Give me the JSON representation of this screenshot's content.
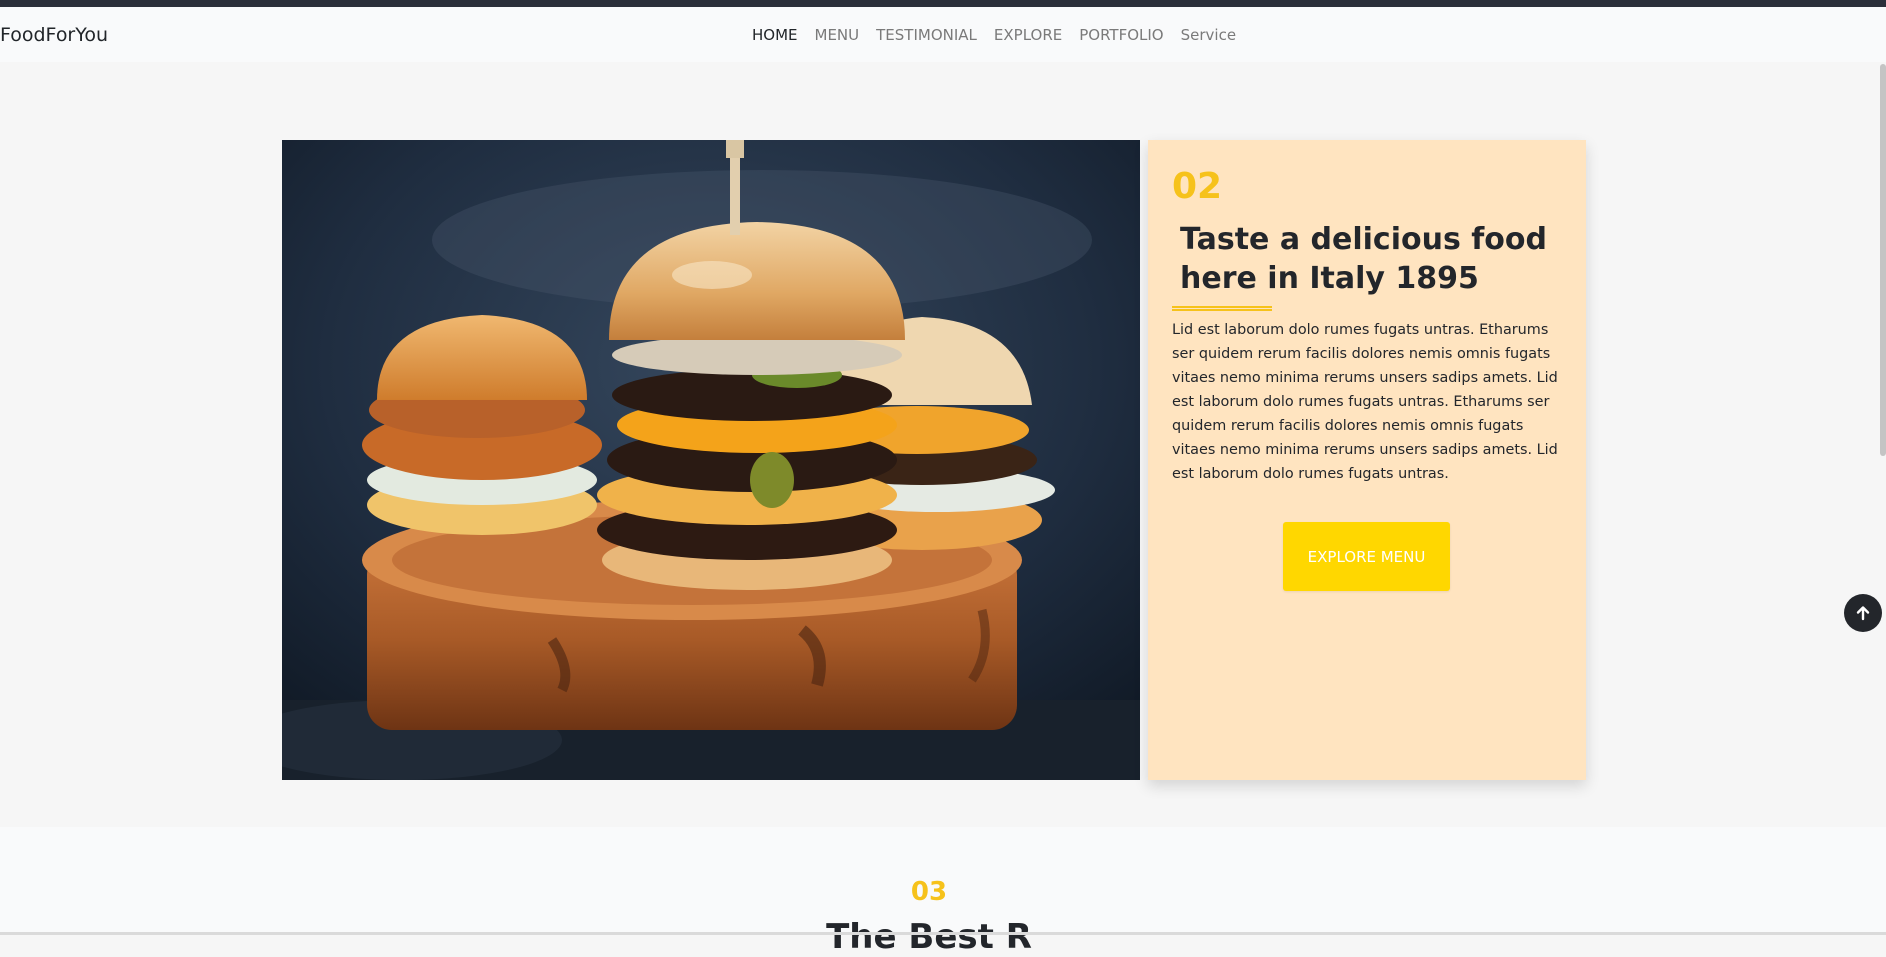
{
  "navbar": {
    "brand": "FoodForYou",
    "links": [
      {
        "label": "HOME",
        "active": true
      },
      {
        "label": "MENU",
        "active": false
      },
      {
        "label": "TESTIMONIAL",
        "active": false
      },
      {
        "label": "EXPLORE",
        "active": false
      },
      {
        "label": "PORTFOLIO",
        "active": false
      },
      {
        "label": "Service",
        "active": false
      }
    ]
  },
  "feature": {
    "number": "02",
    "title": "Taste a delicious food here in Italy 1895",
    "body": "Lid est laborum dolo rumes fugats untras. Etharums ser quidem rerum facilis dolores nemis omnis fugats vitaes nemo minima rerums unsers sadips amets. Lid est laborum dolo rumes fugats untras. Etharums ser quidem rerum facilis dolores nemis omnis fugats vitaes nemo minima rerums unsers sadips amets. Lid est laborum dolo rumes fugats untras.",
    "button_label": "EXPLORE MENU",
    "image_icon": "burger-photo"
  },
  "next_section": {
    "number": "03",
    "title_partial": "The Best R"
  },
  "icons": {
    "scroll_top": "arrow-up-icon"
  },
  "colors": {
    "accent_yellow": "#f6c21b",
    "button_yellow": "#ffd700",
    "card_background": "#ffe4c0",
    "dark_text": "#23262b",
    "topbar": "#2b2f3a"
  }
}
